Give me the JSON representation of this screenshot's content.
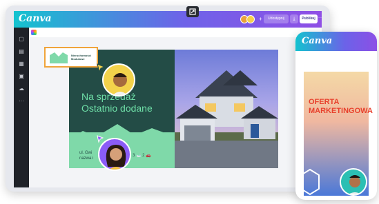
{
  "editor": {
    "brand": "Canva",
    "share_label": "Udostępnij",
    "download_icon": "⤓",
    "publish_label": "Publikuj",
    "more_label": "···",
    "avatar_colors": [
      "#e9a23b",
      "#f5d04d"
    ],
    "plus": "+",
    "sidebar_icons": [
      "▢",
      "▤",
      "▦",
      "▣",
      "☁",
      "···"
    ]
  },
  "design": {
    "headline_line1": "Na sprzedaż",
    "headline_line2": "Ostatnio dodane",
    "address_line1": "ul. Gwi",
    "address_line2": "nazwa i",
    "stat_icons": "3   🛁 2  🚗",
    "logo_text_line1": "Nieruchomości",
    "logo_text_line2": "Modułowe"
  },
  "phone": {
    "brand": "Canva",
    "title_line1": "OFERTA",
    "title_line2": "MARKETINGOWA"
  },
  "colors": {
    "brand_gradient_start": "#14c3cf",
    "brand_gradient_end": "#8f4fe6",
    "design_dark": "#234c46",
    "design_mint": "#7fd9a9",
    "headline": "#6fe0a8",
    "selection": "#f0a43a",
    "phone_title": "#e8412d"
  }
}
